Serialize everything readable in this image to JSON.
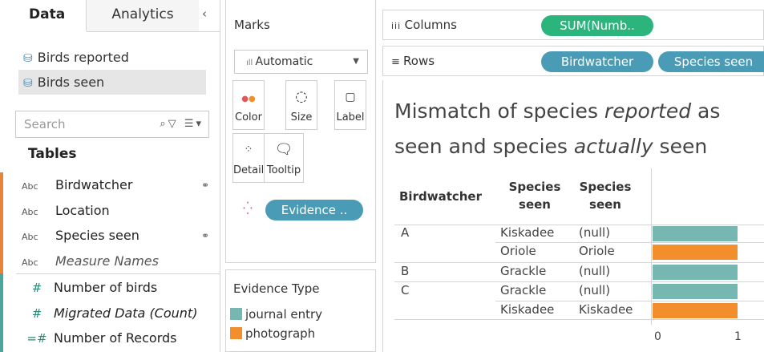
{
  "left_panel": {
    "tabs": {
      "data": "Data",
      "analytics": "Analytics"
    },
    "collapse_icon": "chevron-left",
    "data_sources": [
      {
        "label": "Birds reported",
        "selected": false
      },
      {
        "label": "Birds seen",
        "selected": true
      }
    ],
    "search_placeholder": "Search",
    "tables_header": "Tables",
    "fields": [
      {
        "type": "Abc",
        "label": "Birdwatcher",
        "linked": true,
        "italic": false
      },
      {
        "type": "Abc",
        "label": "Location",
        "linked": false,
        "italic": false
      },
      {
        "type": "Abc",
        "label": "Species seen",
        "linked": true,
        "italic": false
      },
      {
        "type": "Abc",
        "label": "Measure Names",
        "linked": false,
        "italic": true
      },
      {
        "type": "#",
        "label": "Number of birds",
        "linked": false,
        "italic": false
      },
      {
        "type": "#",
        "label": "Migrated Data (Count)",
        "linked": false,
        "italic": true
      },
      {
        "type": "=#",
        "label": "Number of Records",
        "linked": false,
        "italic": false
      }
    ]
  },
  "marks": {
    "title": "Marks",
    "mark_type": "Automatic",
    "cards": [
      {
        "label": "Color",
        "icon": "color-dots"
      },
      {
        "label": "Size",
        "icon": "size-shape"
      },
      {
        "label": "Label",
        "icon": "label-T"
      },
      {
        "label": "Detail",
        "icon": "detail-dots"
      },
      {
        "label": "Tooltip",
        "icon": "tooltip-bubble"
      }
    ],
    "color_pill": "Evidence .."
  },
  "legend": {
    "title": "Evidence Type",
    "items": [
      {
        "label": "journal entry",
        "color": "#76b7b2"
      },
      {
        "label": "photograph",
        "color": "#f28e2b"
      }
    ]
  },
  "shelves": {
    "columns_label": "Columns",
    "rows_label": "Rows",
    "columns_pills": [
      "SUM(Numb.."
    ],
    "rows_pills": [
      "Birdwatcher",
      "Species seen"
    ]
  },
  "view": {
    "title_line1_a": "Mismatch of species ",
    "title_line1_b": "reported",
    "title_line1_c": " as",
    "title_line2_a": "seen and species ",
    "title_line2_b": "actually",
    "title_line2_c": " seen",
    "headers": [
      "Birdwatcher",
      "Species seen",
      "Species seen"
    ],
    "rows": [
      {
        "birdwatcher": "A",
        "reported": "Kiskadee",
        "seen": "(null)",
        "value": 1,
        "evidence": "journal entry"
      },
      {
        "birdwatcher": "",
        "reported": "Oriole",
        "seen": "Oriole",
        "value": 1,
        "evidence": "photograph"
      },
      {
        "birdwatcher": "B",
        "reported": "Grackle",
        "seen": "(null)",
        "value": 1,
        "evidence": "journal entry"
      },
      {
        "birdwatcher": "C",
        "reported": "Grackle",
        "seen": "(null)",
        "value": 1,
        "evidence": "journal entry"
      },
      {
        "birdwatcher": "",
        "reported": "Kiskadee",
        "seen": "Kiskadee",
        "value": 1,
        "evidence": "photograph"
      }
    ],
    "axis_ticks": [
      "0",
      "1"
    ]
  },
  "chart_data": {
    "type": "bar",
    "categories": [
      "A / Kiskadee / (null)",
      "A / Oriole / Oriole",
      "B / Grackle / (null)",
      "C / Grackle / (null)",
      "C / Kiskadee / Kiskadee"
    ],
    "values": [
      1,
      1,
      1,
      1,
      1
    ],
    "colors_by": "Evidence Type",
    "xlim": [
      0,
      1
    ]
  }
}
